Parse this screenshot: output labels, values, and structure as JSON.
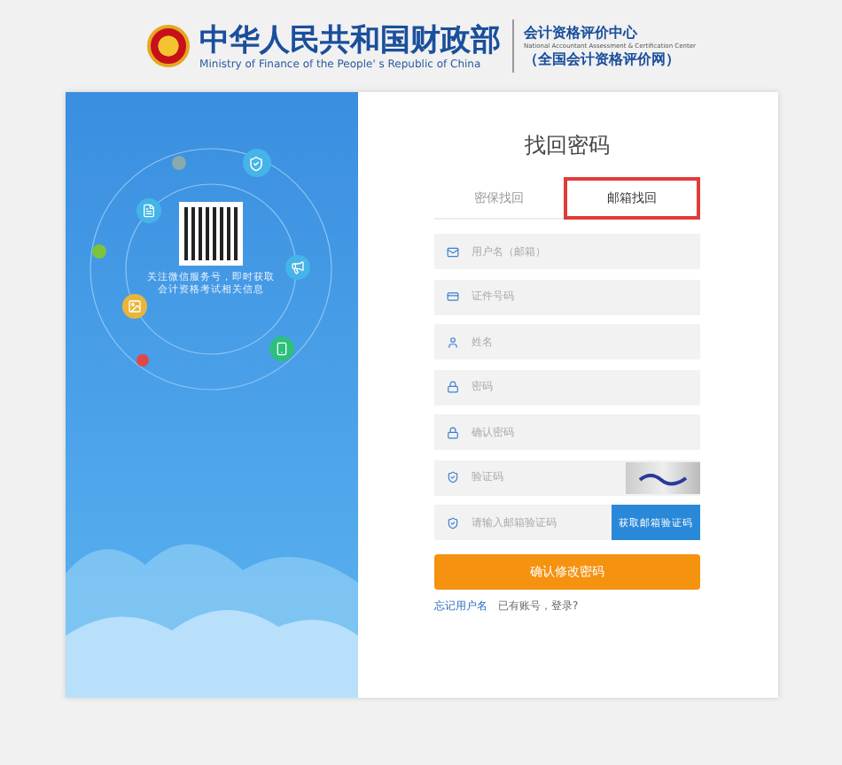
{
  "header": {
    "title": "中华人民共和国财政部",
    "subtitle": "Ministry of Finance of the People' s Republic of China",
    "center_name": "会计资格评价中心",
    "center_english": "National Accountant Assessment & Certification Center",
    "site_name": "（全国会计资格评价网）"
  },
  "promo": {
    "caption_lines": [
      "关注微信服务号，即时获取",
      "会计资格考试相关信息"
    ]
  },
  "form": {
    "title": "找回密码",
    "tabs": [
      {
        "label": "密保找回",
        "selected": false
      },
      {
        "label": "邮箱找回",
        "selected": true
      }
    ],
    "fields": [
      {
        "kind": "text",
        "placeholder": "用户名（邮箱）"
      },
      {
        "kind": "text",
        "placeholder": "证件号码"
      },
      {
        "kind": "text",
        "placeholder": "姓名"
      },
      {
        "kind": "text",
        "placeholder": "密码"
      },
      {
        "kind": "text",
        "placeholder": "确认密码"
      },
      {
        "kind": "captcha",
        "placeholder": "验证码"
      },
      {
        "kind": "code",
        "placeholder": "请输入邮箱验证码",
        "button": "获取邮箱验证码"
      }
    ],
    "submit": "确认修改密码",
    "links": [
      {
        "label": "忘记用户名",
        "kind": "link"
      },
      {
        "label": "已有账号，登录?",
        "kind": "text"
      }
    ]
  }
}
